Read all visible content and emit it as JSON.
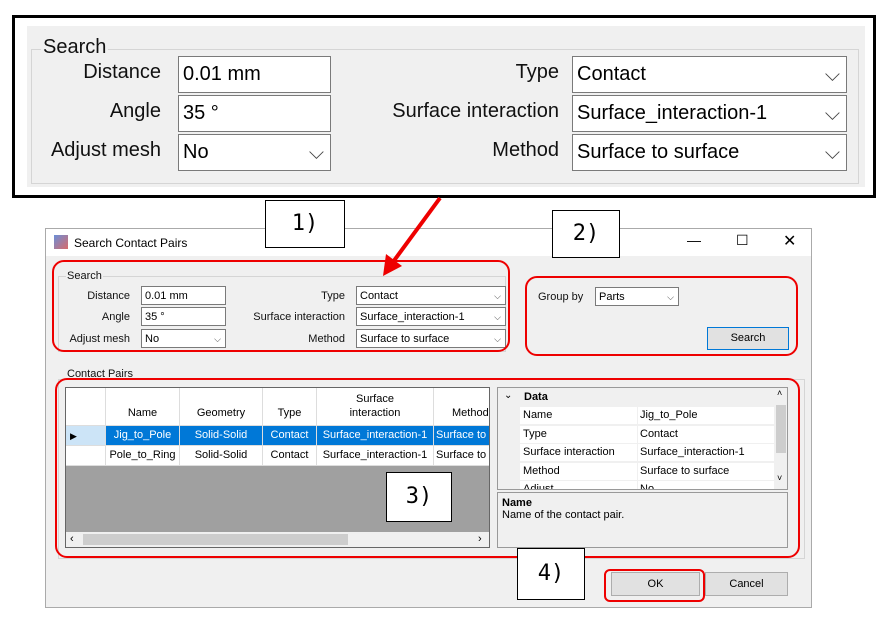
{
  "inset": {
    "group_label": "Search",
    "distance_label": "Distance",
    "distance_value": "0.01 mm",
    "angle_label": "Angle",
    "angle_value": "35 °",
    "adjust_label": "Adjust mesh",
    "adjust_value": "No",
    "type_label": "Type",
    "type_value": "Contact",
    "surface_label": "Surface interaction",
    "surface_value": "Surface_interaction-1",
    "method_label": "Method",
    "method_value": "Surface to surface"
  },
  "callouts": [
    "1)",
    "2)",
    "3)",
    "4)"
  ],
  "annotation_color": "#e00000",
  "dialog": {
    "title": "Search Contact Pairs",
    "search": {
      "group_label": "Search",
      "distance_label": "Distance",
      "distance_value": "0.01 mm",
      "angle_label": "Angle",
      "angle_value": "35 °",
      "adjust_label": "Adjust mesh",
      "adjust_value": "No",
      "type_label": "Type",
      "type_value": "Contact",
      "surface_label": "Surface interaction",
      "surface_value": "Surface_interaction-1",
      "method_label": "Method",
      "method_value": "Surface to surface"
    },
    "group_by_label": "Group by",
    "group_by_value": "Parts",
    "search_button": "Search",
    "contact_pairs_label": "Contact Pairs",
    "columns": [
      "Name",
      "Geometry",
      "Type",
      "Surface interaction",
      "Method"
    ],
    "rows": [
      [
        "Jig_to_Pole",
        "Solid-Solid",
        "Contact",
        "Surface_interaction-1",
        "Surface to surface"
      ],
      [
        "Pole_to_Ring",
        "Solid-Solid",
        "Contact",
        "Surface_interaction-1",
        "Surface to surface"
      ]
    ],
    "properties": {
      "category": "Data",
      "items": [
        {
          "name": "Name",
          "value": "Jig_to_Pole"
        },
        {
          "name": "Type",
          "value": "Contact"
        },
        {
          "name": "Surface interaction",
          "value": "Surface_interaction-1"
        },
        {
          "name": "Method",
          "value": "Surface to surface"
        },
        {
          "name": "Adjust",
          "value": "No"
        }
      ]
    },
    "description": {
      "title": "Name",
      "text": "Name of the contact pair."
    },
    "ok_button": "OK",
    "cancel_button": "Cancel",
    "selection_color": "#0078d7"
  }
}
